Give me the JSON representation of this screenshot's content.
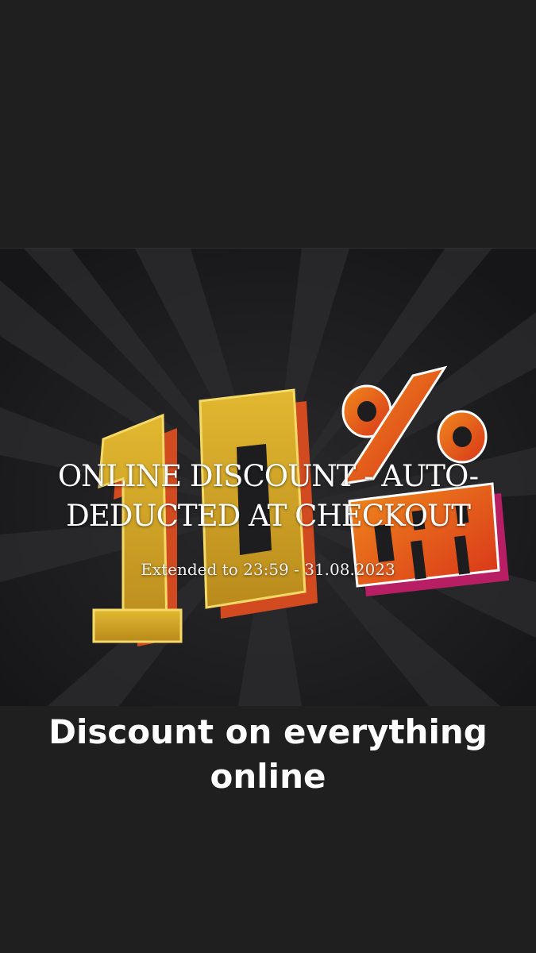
{
  "banner": {
    "graphic_text": {
      "number": "10",
      "percent": "%",
      "off": "OFF"
    },
    "title": "ONLINE DISCOUNT - AUTO-DEDUCTED AT CHECKOUT",
    "subtitle": "Extended to 23:59 - 31.08.2023",
    "colors": {
      "gold": "#c9a21f",
      "orange": "#e0531c",
      "background": "#1a1a1c"
    }
  },
  "caption": {
    "text": "Discount on everything online"
  }
}
